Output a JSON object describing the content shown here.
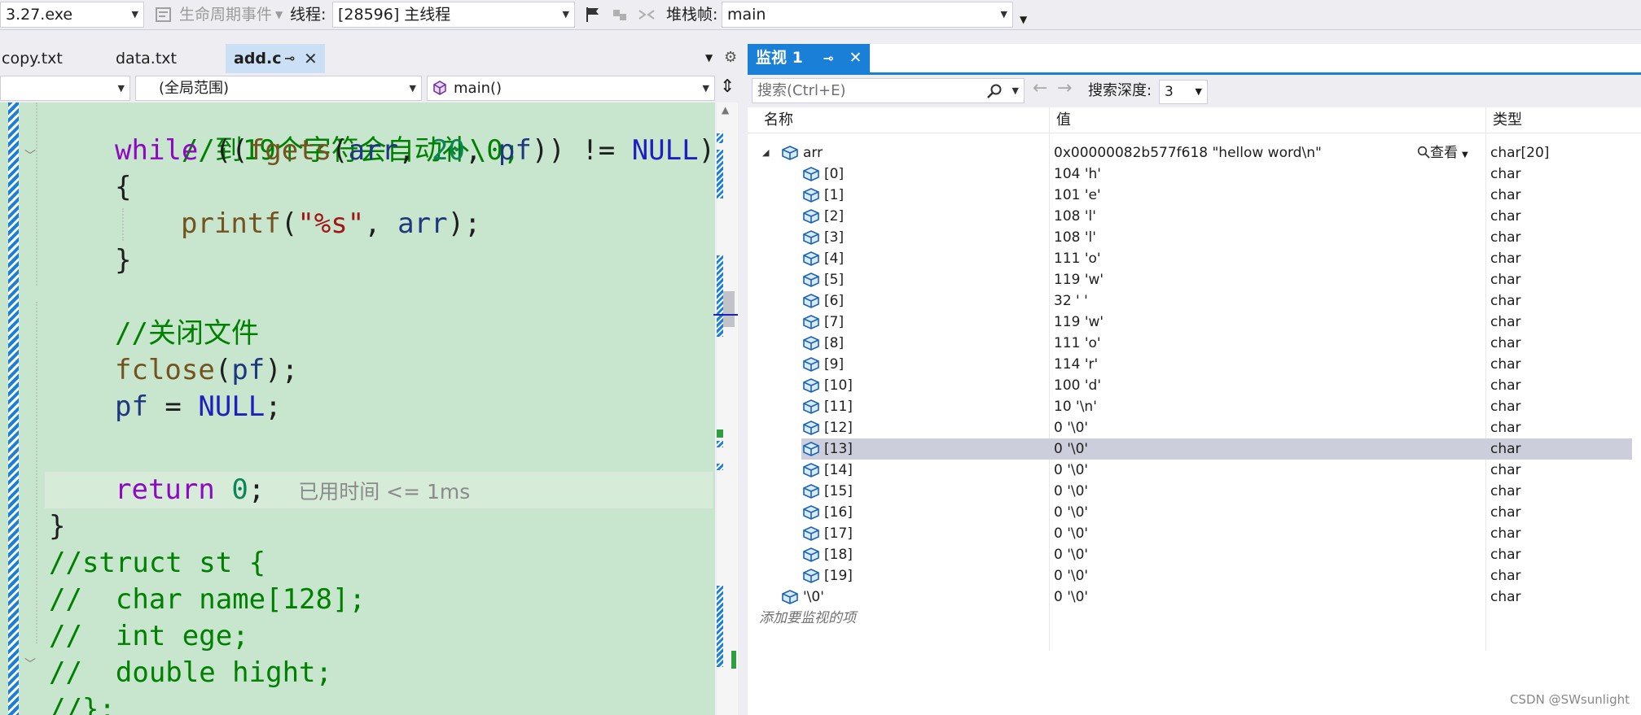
{
  "toolbar": {
    "process": "3.27.exe",
    "lifecycle": "生命周期事件",
    "thread_label": "线程:",
    "thread_value": "[28596] 主线程",
    "stack_label": "堆栈帧:",
    "stack_value": "main"
  },
  "editor": {
    "tabs": [
      {
        "label": "copy.txt"
      },
      {
        "label": "data.txt"
      },
      {
        "label": "add.c"
      }
    ],
    "nav": {
      "scope": "(全局范围)",
      "function": "main()"
    },
    "perf_tip": "已用时间 <= 1ms"
  },
  "code": {
    "l1_cmt": "//到19个字符会自动补\\0;",
    "l2_while": "while",
    "l2_a": " ((",
    "l2_fgets": "fgets",
    "l2_b": "(",
    "l2_arr": "arr",
    "l2_c": ", ",
    "l2_num": "20",
    "l2_d": ", ",
    "l2_pf": "pf",
    "l2_e": ")) != ",
    "l2_null": "NULL",
    "l2_f": ")",
    "l3": "{",
    "l4_printf": "printf",
    "l4_a": "(",
    "l4_str": "\"%s\"",
    "l4_b": ", ",
    "l4_arr": "arr",
    "l4_c": ");",
    "l5": "}",
    "l7_cmt": "//关闭文件",
    "l8_fclose": "fclose",
    "l8_a": "(",
    "l8_pf": "pf",
    "l8_b": ");",
    "l9_pf": "pf",
    "l9_a": " = ",
    "l9_null": "NULL",
    "l9_b": ";",
    "l11_return": "return",
    "l11_a": " ",
    "l11_num": "0",
    "l11_b": ";",
    "l12": "}",
    "l13_cmt": "//struct st {",
    "l14_cmt": "//  char name[128];",
    "l15_cmt": "//  int ege;",
    "l16_cmt": "//  double hight;",
    "l17_cmt": "//};"
  },
  "watch": {
    "tab_label": "监视 1",
    "search_placeholder": "搜索(Ctrl+E)",
    "depth_label": "搜索深度:",
    "depth_value": "3",
    "headers": {
      "name": "名称",
      "value": "值",
      "type": "类型"
    },
    "view_label": "查看",
    "root": {
      "name": "arr",
      "value": "0x00000082b577f618 \"hellow word\\n\"",
      "type": "char[20]"
    },
    "items": [
      {
        "name": "[0]",
        "value": "104 'h'",
        "type": "char"
      },
      {
        "name": "[1]",
        "value": "101 'e'",
        "type": "char"
      },
      {
        "name": "[2]",
        "value": "108 'l'",
        "type": "char"
      },
      {
        "name": "[3]",
        "value": "108 'l'",
        "type": "char"
      },
      {
        "name": "[4]",
        "value": "111 'o'",
        "type": "char"
      },
      {
        "name": "[5]",
        "value": "119 'w'",
        "type": "char"
      },
      {
        "name": "[6]",
        "value": "32 ' '",
        "type": "char"
      },
      {
        "name": "[7]",
        "value": "119 'w'",
        "type": "char"
      },
      {
        "name": "[8]",
        "value": "111 'o'",
        "type": "char"
      },
      {
        "name": "[9]",
        "value": "114 'r'",
        "type": "char"
      },
      {
        "name": "[10]",
        "value": "100 'd'",
        "type": "char"
      },
      {
        "name": "[11]",
        "value": "10 '\\n'",
        "type": "char"
      },
      {
        "name": "[12]",
        "value": "0 '\\0'",
        "type": "char"
      },
      {
        "name": "[13]",
        "value": "0 '\\0'",
        "type": "char"
      },
      {
        "name": "[14]",
        "value": "0 '\\0'",
        "type": "char"
      },
      {
        "name": "[15]",
        "value": "0 '\\0'",
        "type": "char"
      },
      {
        "name": "[16]",
        "value": "0 '\\0'",
        "type": "char"
      },
      {
        "name": "[17]",
        "value": "0 '\\0'",
        "type": "char"
      },
      {
        "name": "[18]",
        "value": "0 '\\0'",
        "type": "char"
      },
      {
        "name": "[19]",
        "value": "0 '\\0'",
        "type": "char"
      }
    ],
    "extra": {
      "name": "'\\0'",
      "value": "0 '\\0'",
      "type": "char"
    },
    "add_placeholder": "添加要监视的项",
    "selected_item": "[13]"
  },
  "watermark": "CSDN @SWsunlight",
  "colors": {
    "accent": "#1a7fd6",
    "code_bg": "#c7e6cd",
    "selected_row": "#cccedb"
  }
}
